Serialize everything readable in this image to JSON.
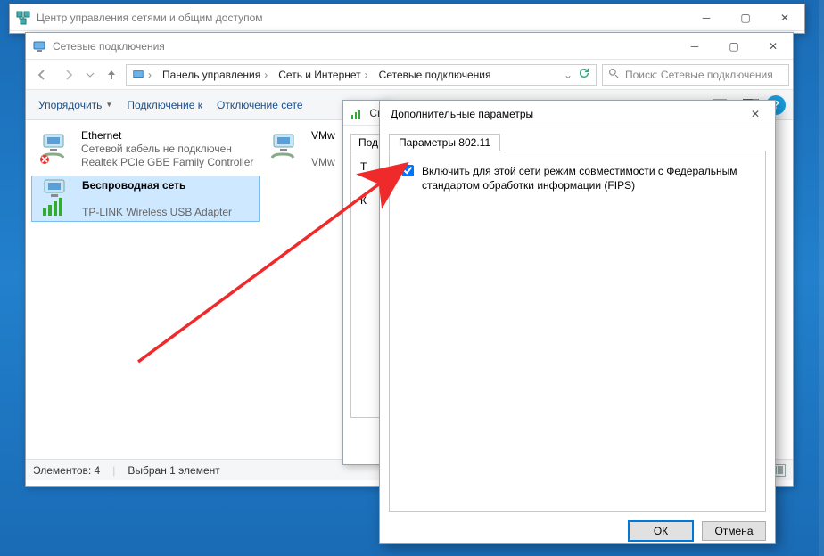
{
  "win_back": {
    "title": "Центр управления сетями и общим доступом"
  },
  "win_main": {
    "title": "Сетевые подключения",
    "breadcrumb": {
      "root": "Панель управления",
      "mid": "Сеть и Интернет",
      "leaf": "Сетевые подключения"
    },
    "search_placeholder": "Поиск: Сетевые подключения",
    "toolbar": {
      "organize": "Упорядочить",
      "connect": "Подключение к",
      "disconnect": "Отключение сете"
    },
    "adapters": [
      {
        "name": "Ethernet",
        "status": "Сетевой кабель не подключен",
        "device": "Realtek PCIe GBE Family Controller",
        "kind": "wired",
        "selected": false
      },
      {
        "name": "VMw",
        "status": "",
        "device": "VMw",
        "kind": "wired",
        "selected": false,
        "truncated": true
      },
      {
        "name": "Беспроводная сеть",
        "status": "",
        "device": "TP-LINK Wireless USB Adapter",
        "kind": "wifi",
        "selected": true
      }
    ],
    "status": {
      "count_label": "Элементов: 4",
      "selected_label": "Выбран 1 элемент"
    }
  },
  "prop_slice": {
    "title": "Сво",
    "tab": "Под",
    "rows": [
      "Т",
      "К"
    ]
  },
  "dialog": {
    "title": "Дополнительные параметры",
    "tab": "Параметры 802.11",
    "checkbox_label": "Включить для этой сети режим совместимости с Федеральным стандартом обработки информации (FIPS)",
    "checked": true,
    "ok": "ОК",
    "cancel": "Отмена"
  }
}
